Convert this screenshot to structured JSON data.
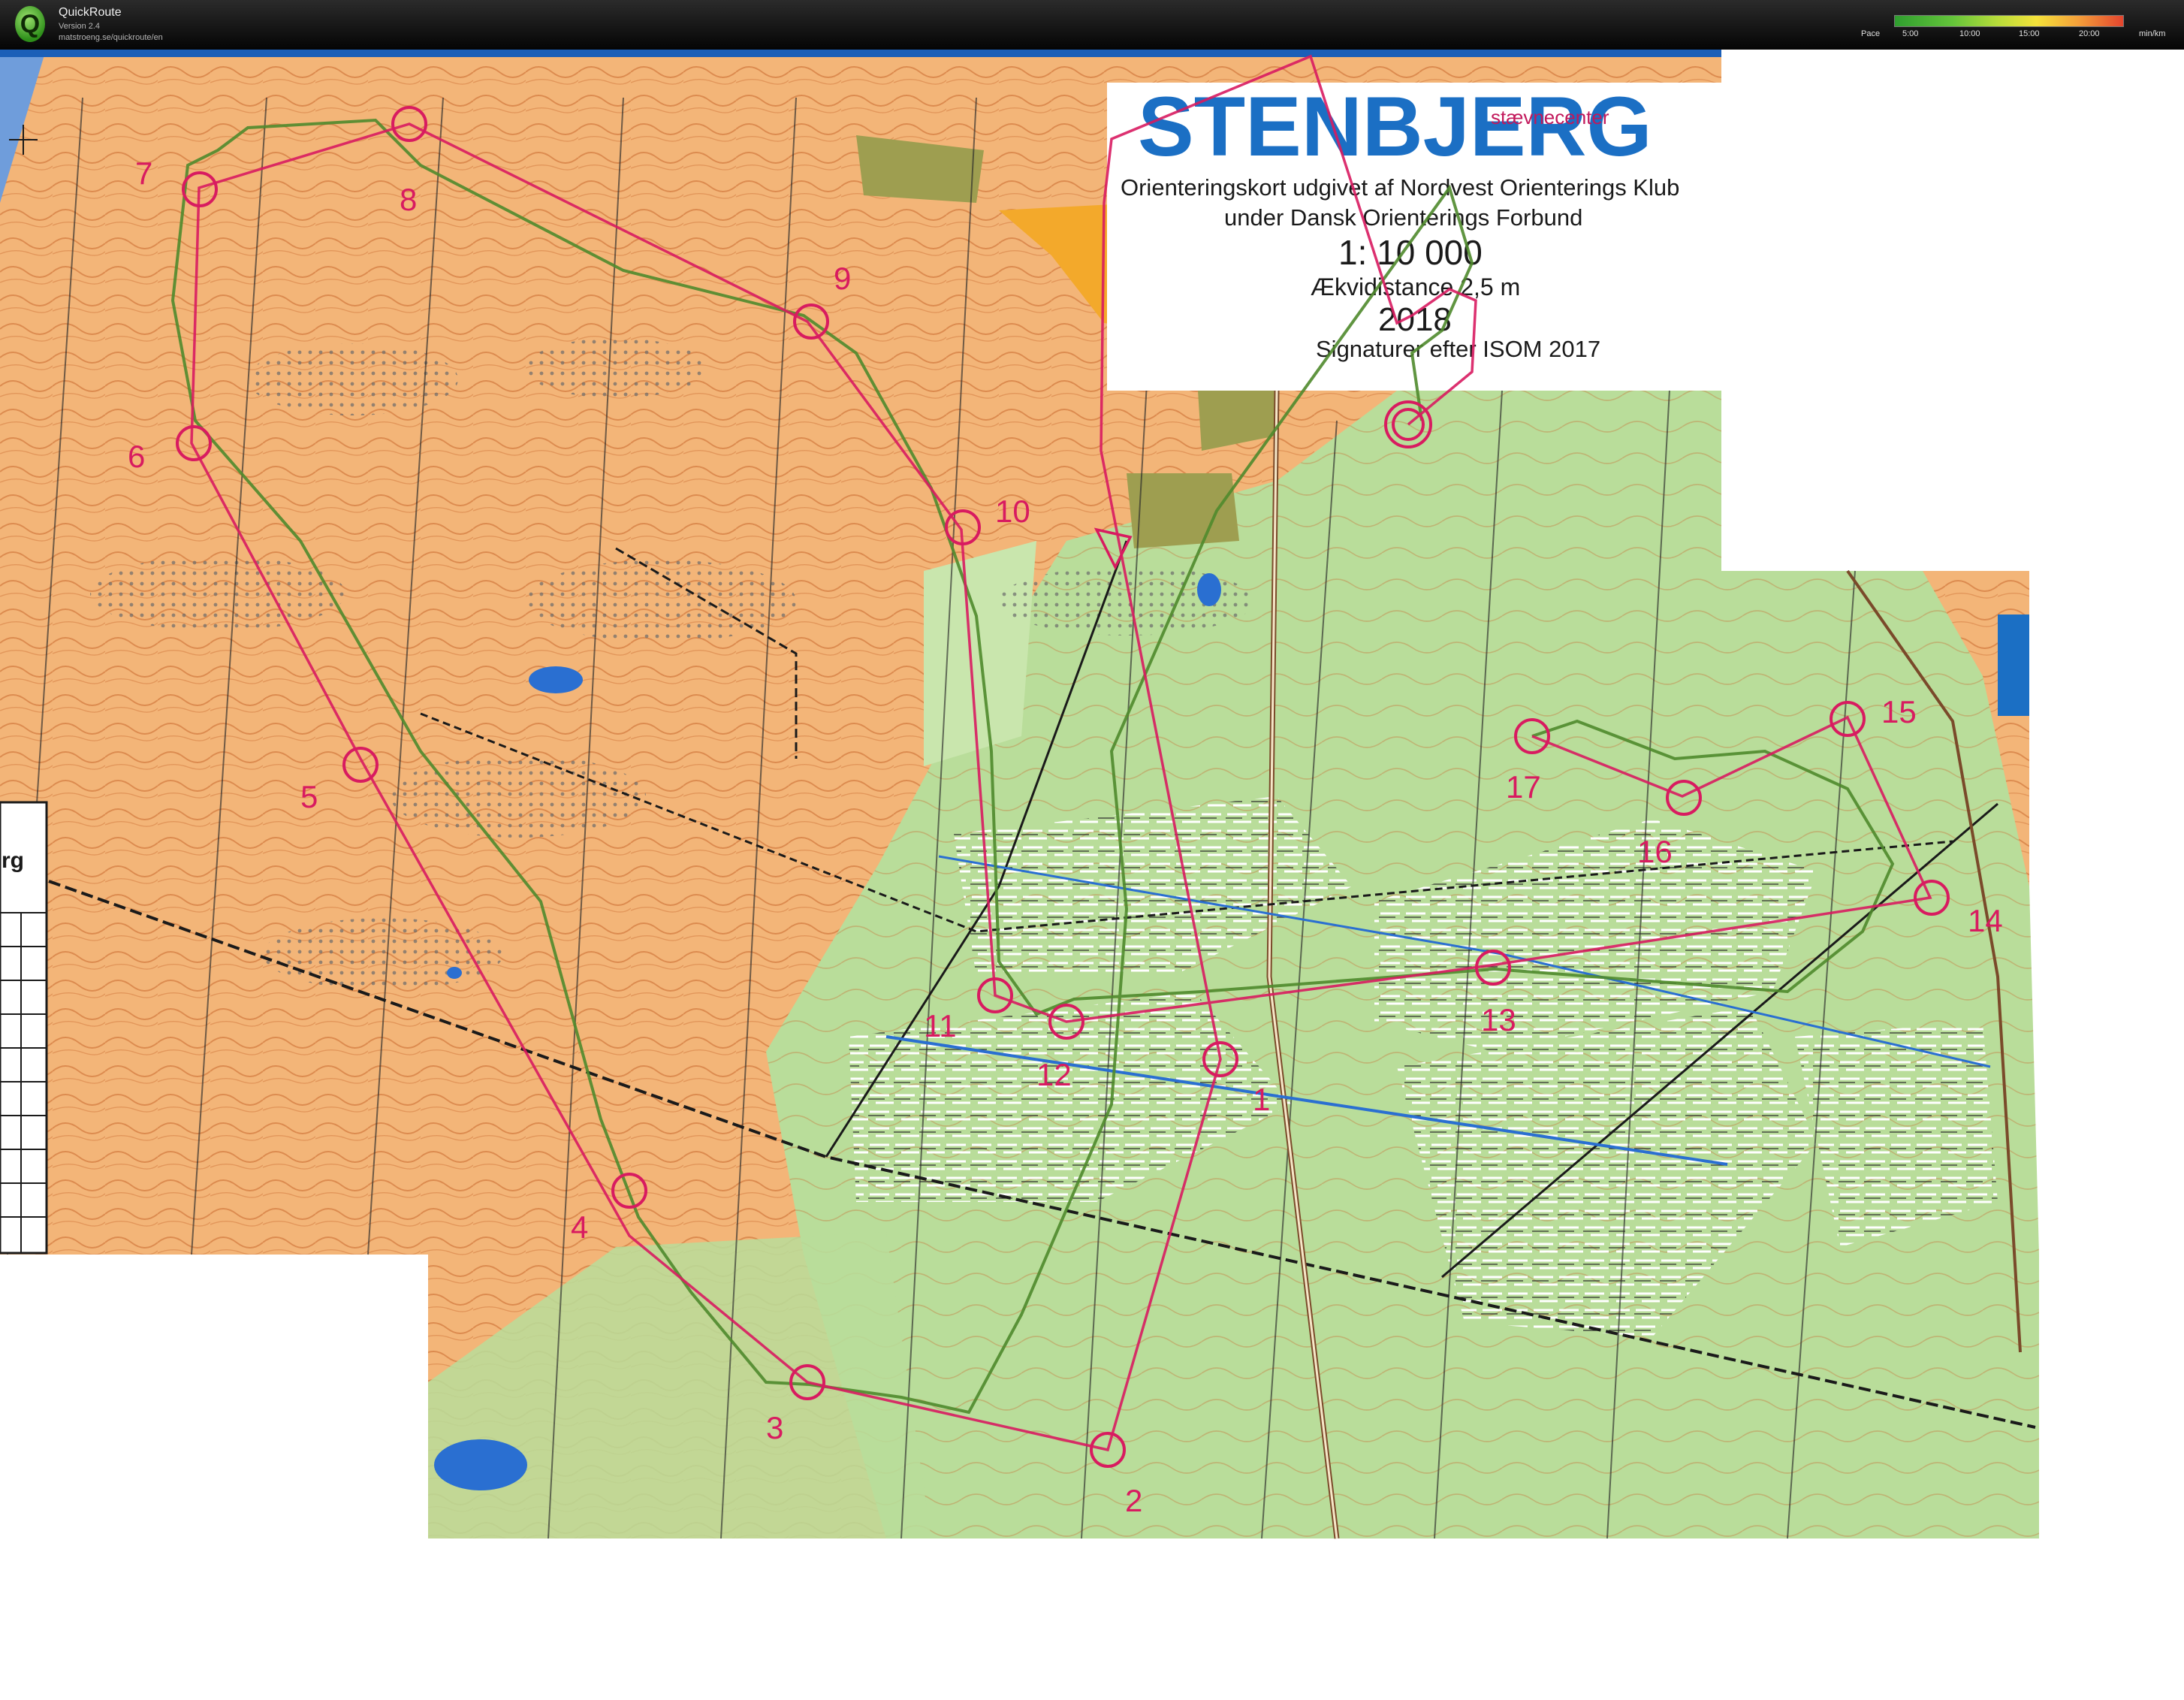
{
  "app": {
    "title": "QuickRoute",
    "version": "Version 2.4",
    "url": "matstroeng.se/quickroute/en"
  },
  "pace_legend": {
    "label": "Pace",
    "ticks": [
      "5:00",
      "10:00",
      "15:00",
      "20:00"
    ],
    "unit": "min/km"
  },
  "map": {
    "title": "STENBJERG",
    "event_center_label": "stævnecenter",
    "publisher_line1": "Orienteringskort udgivet af Nordvest Orienterings Klub",
    "publisher_line2": "under Dansk Orienterings Forbund",
    "scale": "1: 10 000",
    "contour_interval": "Ækvidistance 2,5 m",
    "year": "2018",
    "symbols_standard": "Signaturer efter ISOM 2017",
    "margin_text": "rg",
    "controls": [
      "1",
      "2",
      "3",
      "4",
      "5",
      "6",
      "7",
      "8",
      "9",
      "10",
      "11",
      "12",
      "13",
      "14",
      "15",
      "16",
      "17"
    ],
    "colors": {
      "open_land": "#f3b578",
      "forest": "#b9dd9a",
      "course": "#d81b60",
      "route": "#4f8a2c",
      "water": "#2a6fd1",
      "title": "#1b6fc4"
    }
  }
}
